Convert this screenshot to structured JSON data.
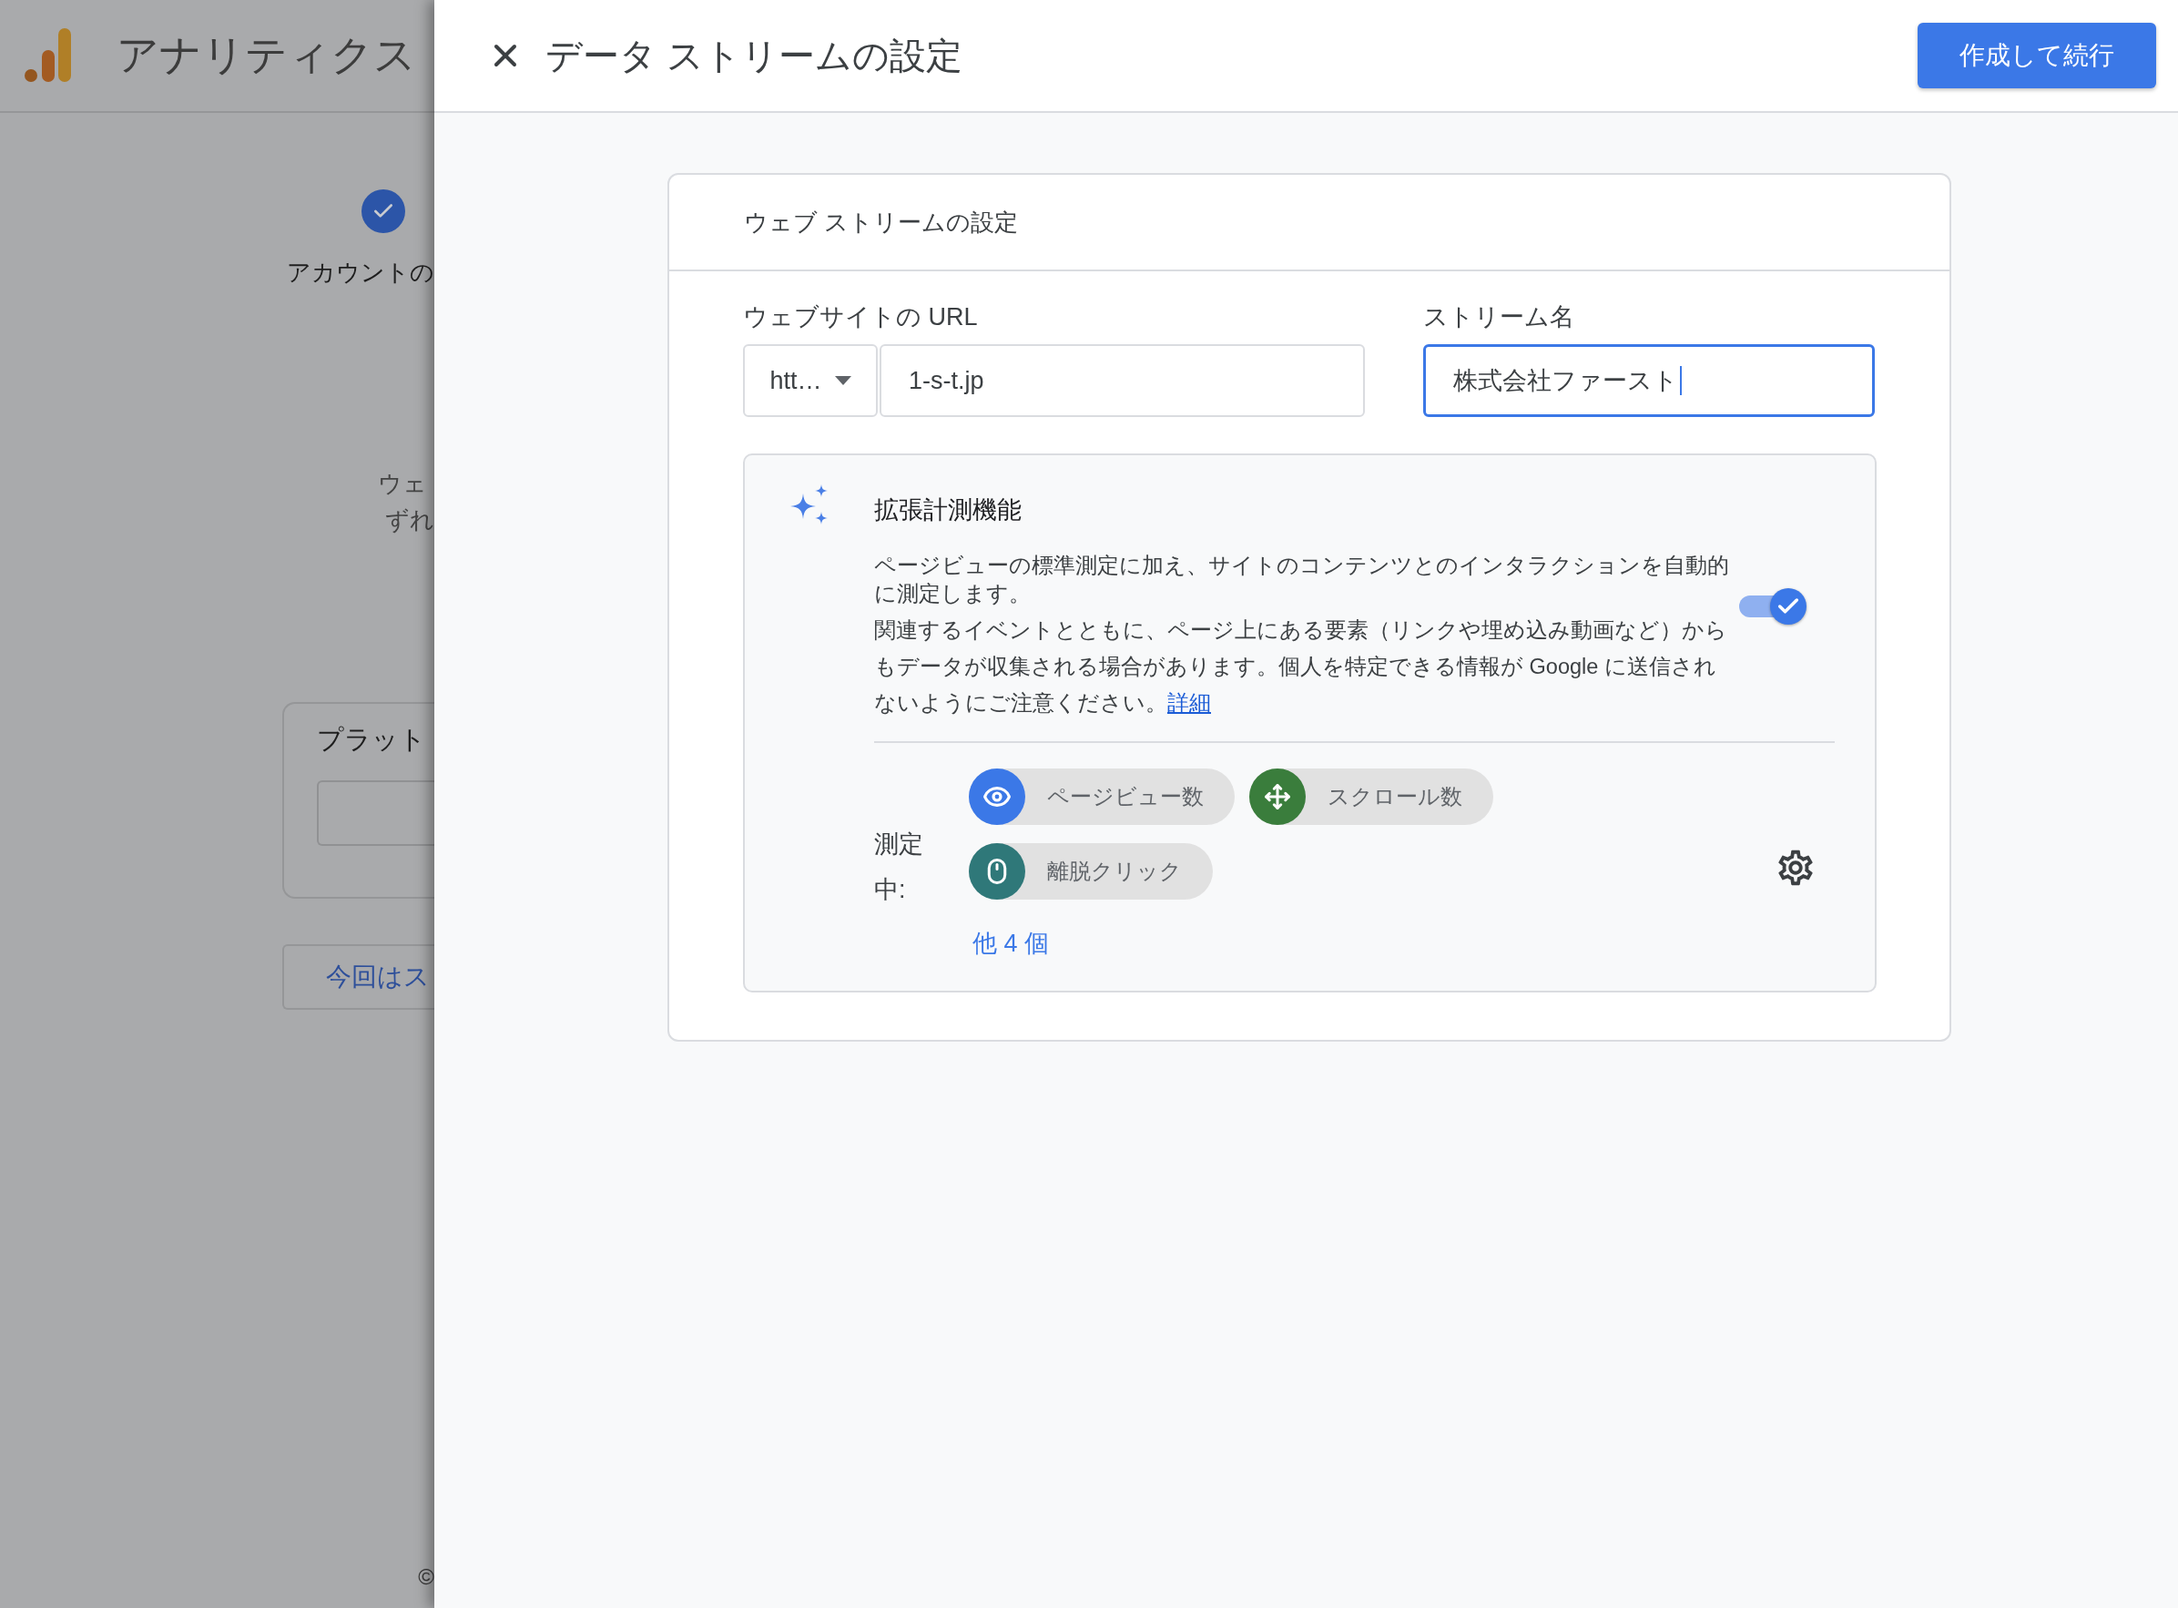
{
  "background_page": {
    "app_name": "アナリティクス",
    "step": {
      "label": "アカウントの",
      "done": true
    },
    "description_lines": [
      "ウェ",
      "ずれ"
    ],
    "platform_card": {
      "title": "プラット"
    },
    "skip_button": "今回はス",
    "footer": "©"
  },
  "dialog": {
    "title": "データ ストリームの設定",
    "primary_button": "作成して続行"
  },
  "card": {
    "title": "ウェブ ストリームの設定",
    "url_field": {
      "label": "ウェブサイトの URL",
      "protocol": "htt…",
      "value": "1-s-t.jp"
    },
    "stream_name_field": {
      "label": "ストリーム名",
      "value": "株式会社ファースト",
      "focused": true
    }
  },
  "enhanced_measurement": {
    "title": "拡張計測機能",
    "description": [
      "ページビューの標準測定に加え、サイトのコンテンツとのインタラクションを自動的に測定します。",
      "関連するイベントとともに、ページ上にある要素（リンクや埋め込み動画など）からもデータが収集される場合があります。個人を特定できる情報が Google に送信されないようにご注意ください。"
    ],
    "link": "詳細",
    "on": true,
    "measuring_label": "測定中:",
    "events": [
      {
        "label": "ページビュー数",
        "kind": "pageview",
        "color": "#3b78e7"
      },
      {
        "label": "スクロール数",
        "kind": "scroll",
        "color": "#3a7d3c"
      },
      {
        "label": "離脱クリック",
        "kind": "click",
        "color": "#2f7879"
      }
    ],
    "more": "他 4 個"
  }
}
